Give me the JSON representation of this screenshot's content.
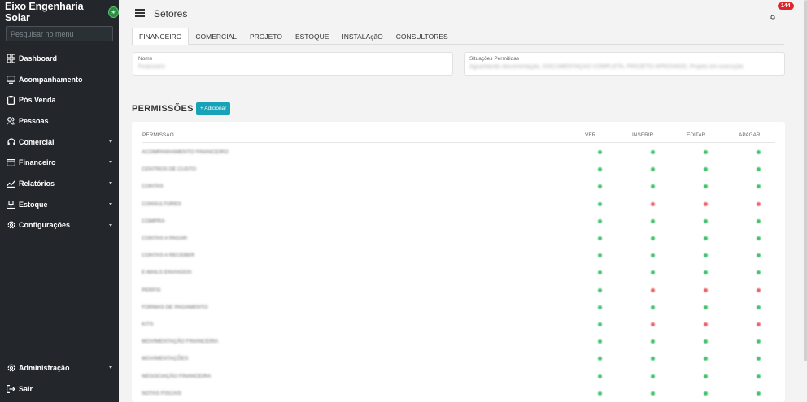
{
  "sidebar": {
    "brand": "Eixo Engenharia Solar",
    "search_placeholder": "Pesquisar no menu",
    "items": [
      {
        "label": "Dashboard",
        "icon": "dashboard-icon"
      },
      {
        "label": "Acompanhamento",
        "icon": "monitor-icon"
      },
      {
        "label": "Pós Venda",
        "icon": "clipboard-icon"
      },
      {
        "label": "Pessoas",
        "icon": "people-icon"
      },
      {
        "label": "Comercial",
        "icon": "headset-icon"
      },
      {
        "label": "Financeiro",
        "icon": "wallet-icon"
      },
      {
        "label": "Relatórios",
        "icon": "chart-icon"
      },
      {
        "label": "Estoque",
        "icon": "boxes-icon"
      },
      {
        "label": "Configurações",
        "icon": "settings-icon"
      }
    ],
    "bottom_items": [
      {
        "label": "Administração",
        "icon": "gear-icon"
      },
      {
        "label": "Sair",
        "icon": "logout-icon"
      }
    ]
  },
  "header": {
    "title": "Setores",
    "notification_count": "144"
  },
  "tabs": [
    "FINANCEIRO",
    "COMERCIAL",
    "PROJETO",
    "ESTOQUE",
    "INSTALAçãO",
    "CONSULTORES"
  ],
  "form": {
    "name_label": "Nome",
    "name_value": "Financeiro",
    "situations_label": "Situações Permitidas",
    "situations_value": "Aguardando documentação, DOCUMENTAÇÃO COMPLETA, PROJETO APROVADO, Projeto em execução"
  },
  "permissions": {
    "title": "PERMISSÕES",
    "add_label": "+ Adicionar",
    "columns": [
      "PERMISSÃO",
      "VER",
      "INSERIR",
      "EDITAR",
      "APAGAR"
    ],
    "rows": [
      {
        "name": "ACOMPANHAMENTO FINANCEIRO",
        "ver": "green",
        "inserir": "green",
        "editar": "green",
        "apagar": "green"
      },
      {
        "name": "CENTROS DE CUSTO",
        "ver": "green",
        "inserir": "green",
        "editar": "green",
        "apagar": "green"
      },
      {
        "name": "CONTAS",
        "ver": "green",
        "inserir": "green",
        "editar": "green",
        "apagar": "green"
      },
      {
        "name": "CONSULTORES",
        "ver": "green",
        "inserir": "red",
        "editar": "red",
        "apagar": "red"
      },
      {
        "name": "COMPRA",
        "ver": "green",
        "inserir": "green",
        "editar": "green",
        "apagar": "green"
      },
      {
        "name": "CONTAS A PAGAR",
        "ver": "green",
        "inserir": "green",
        "editar": "green",
        "apagar": "green"
      },
      {
        "name": "CONTAS A RECEBER",
        "ver": "green",
        "inserir": "green",
        "editar": "green",
        "apagar": "green"
      },
      {
        "name": "E-MAILS ENVIADOS",
        "ver": "green",
        "inserir": "green",
        "editar": "green",
        "apagar": "green"
      },
      {
        "name": "PERFIS",
        "ver": "green",
        "inserir": "red",
        "editar": "red",
        "apagar": "red"
      },
      {
        "name": "FORMAS DE PAGAMENTO",
        "ver": "green",
        "inserir": "green",
        "editar": "green",
        "apagar": "green"
      },
      {
        "name": "KITS",
        "ver": "green",
        "inserir": "red",
        "editar": "red",
        "apagar": "red"
      },
      {
        "name": "MOVIMENTAÇÃO FINANCEIRA",
        "ver": "green",
        "inserir": "green",
        "editar": "green",
        "apagar": "green"
      },
      {
        "name": "MOVIMENTAÇÕES",
        "ver": "green",
        "inserir": "green",
        "editar": "green",
        "apagar": "green"
      },
      {
        "name": "NEGOCIAÇÃO FINANCEIRA",
        "ver": "green",
        "inserir": "green",
        "editar": "green",
        "apagar": "green"
      },
      {
        "name": "NOTAS FISCAIS",
        "ver": "green",
        "inserir": "green",
        "editar": "green",
        "apagar": "green"
      }
    ]
  },
  "colors": {
    "sidebar_bg": "#23272b",
    "accent": "#17a2b8",
    "allowed": "#3fbf6a",
    "denied": "#e86068",
    "badge": "#d9272e"
  }
}
